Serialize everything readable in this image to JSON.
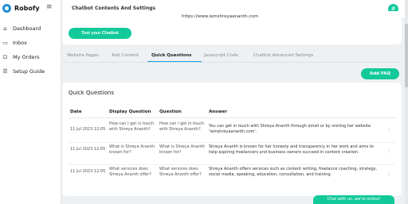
{
  "brand": {
    "name": "Robofy",
    "logo_icon": "robofy-logo-icon"
  },
  "sidebar": {
    "toggle_icon": "hamburger-icon",
    "items": [
      {
        "label": "Dashboard",
        "icon": "home-icon",
        "glyph": "⌂"
      },
      {
        "label": "Inbox",
        "icon": "inbox-icon",
        "glyph": "▭"
      },
      {
        "label": "My Orders",
        "icon": "cart-icon",
        "glyph": "⊡"
      },
      {
        "label": "Setup Guide",
        "icon": "list-icon",
        "glyph": "☰"
      }
    ]
  },
  "header": {
    "title": "Chatbot Contents And Settings",
    "avatar_label": "#"
  },
  "top_card": {
    "url_text": "https://www.iamshreyaananth.com",
    "test_button": "Test your Chatbot"
  },
  "tabs": [
    {
      "label": "Website Pages"
    },
    {
      "label": "Add Content"
    },
    {
      "label": "Quick Questions",
      "active": true
    },
    {
      "label": "Javascript Code"
    },
    {
      "label": "Chatbot Advanced Settings"
    }
  ],
  "add_faq_button": "Add FAQ",
  "quick_questions": {
    "title": "Quick Questions",
    "columns": [
      "Date",
      "Display Question",
      "Question",
      "Answer"
    ],
    "rows": [
      {
        "date": "11 Jul 2023 12:05",
        "display_question": "How can I get in touch with Shreya Ananth?",
        "question": "How can I get in touch with Shreya Ananth?",
        "answer": "You can get in touch with Shreya Ananth through email or by visiting her website 'iamshreyaananth.com'."
      },
      {
        "date": "11 Jul 2023 12:05",
        "display_question": "What is Shreya Ananth known for?",
        "question": "What is Shreya Ananth known for?",
        "answer": "Shreya Ananth is known for her honesty and transparency in her work and aims to help aspiring freelancers and business owners succeed in content creation."
      },
      {
        "date": "11 Jul 2023 12:05",
        "display_question": "What services does Shreya Ananth offer?",
        "question": "What services does Shreya Ananth offer?",
        "answer": "Shreya Ananth offers services such as content writing, freelance coaching, strategy, social media, speaking, education, consultation, and training."
      }
    ]
  },
  "chat_widget": {
    "label": "Chat with us, we're online!"
  },
  "colors": {
    "accent": "#12c99a",
    "tab_underline": "#1aa2e6",
    "logo": "#1f8fd6"
  }
}
